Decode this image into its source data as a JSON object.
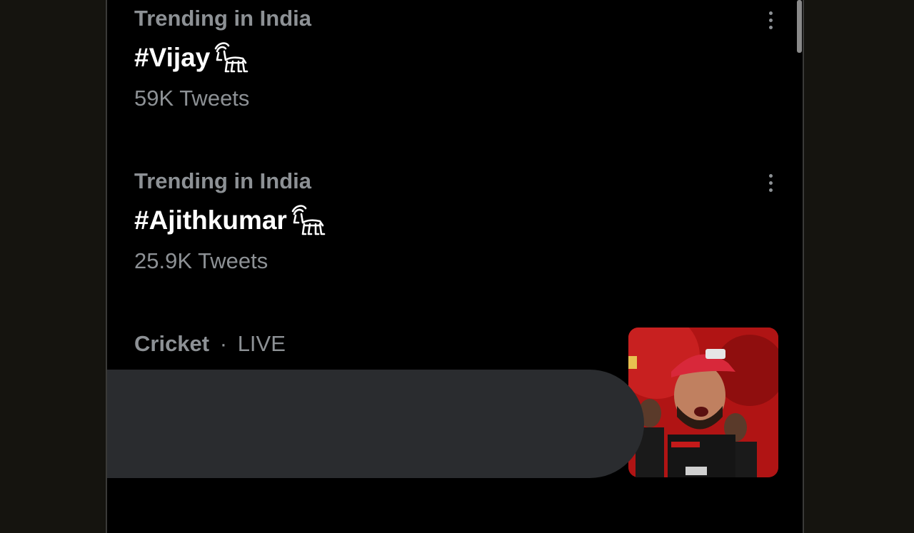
{
  "trends": [
    {
      "context": "Trending in India",
      "hashtag": "#Vijay",
      "tweets": "59K Tweets"
    },
    {
      "context": "Trending in India",
      "hashtag": "#Ajithkumar",
      "tweets": "25.9K Tweets"
    }
  ],
  "cricket": {
    "category": "Cricket",
    "separator": "·",
    "status": "LIVE"
  },
  "colors": {
    "background": "#000000",
    "muted_text": "#8d9195",
    "primary_text": "#ffffff",
    "redaction": "#2a2c2f",
    "thumb_red": "#c81818"
  },
  "icons": [
    "goat-emoji-icon",
    "more-options-icon"
  ]
}
